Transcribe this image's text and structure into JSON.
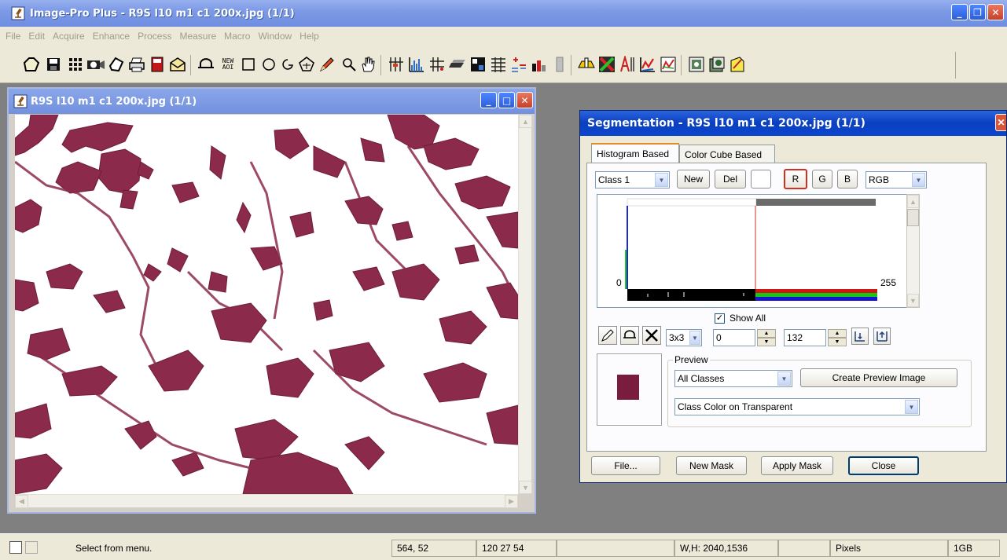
{
  "app": {
    "title": "Image-Pro Plus - R9S l10 m1 c1 200x.jpg (1/1)",
    "menu": [
      "File",
      "Edit",
      "Acquire",
      "Enhance",
      "Process",
      "Measure",
      "Macro",
      "Window",
      "Help"
    ],
    "toolbar_new_aoi": "NEW AOI"
  },
  "image_window": {
    "title": "R9S l10 m1 c1 200x.jpg (1/1)"
  },
  "segmentation": {
    "title": "Segmentation - R9S l10 m1 c1 200x.jpg (1/1)",
    "tabs": [
      "Histogram Based",
      "Color Cube Based"
    ],
    "class_select": "Class 1",
    "new_label": "New",
    "del_label": "Del",
    "channel_r": "R",
    "channel_g": "G",
    "channel_b": "B",
    "color_model": "RGB",
    "hist_min": "0",
    "hist_max": "255",
    "show_all_label": "Show All",
    "show_all_checked": true,
    "kernel_size": "3x3",
    "range_low": "0",
    "range_high": "132",
    "preview_label": "Preview",
    "preview_classes": "All Classes",
    "create_preview_label": "Create Preview Image",
    "preview_mode": "Class Color on Transparent",
    "class_color": "#7a1c3e",
    "file_label": "File...",
    "new_mask_label": "New Mask",
    "apply_mask_label": "Apply Mask",
    "close_label": "Close"
  },
  "status": {
    "message": "Select from menu.",
    "coords": "564, 52",
    "rgb": "120 27 54",
    "dimensions": "W,H: 2040,1536",
    "units": "Pixels",
    "memory": "1GB"
  },
  "colors": {
    "tissue": "#8b2a4a",
    "tissue_dark": "#6e1d38",
    "accent_red": "#d03020"
  }
}
